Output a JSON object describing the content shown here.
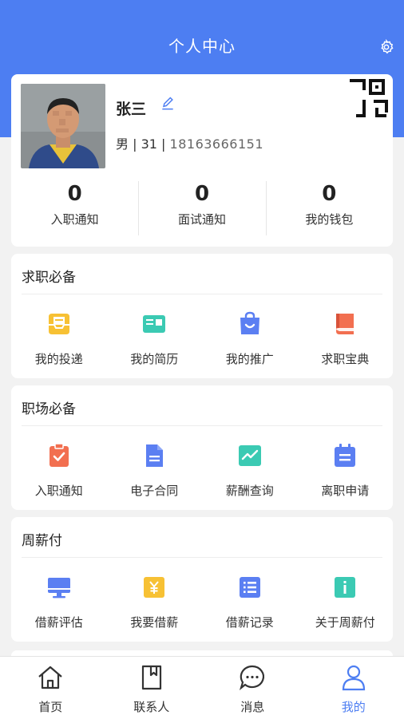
{
  "header": {
    "title": "个人中心",
    "bg_color": "#4d7ef2"
  },
  "profile": {
    "name": "张三",
    "gender": "男",
    "age": "31",
    "phone": "18163666151"
  },
  "stats": [
    {
      "value": "0",
      "label": "入职通知"
    },
    {
      "value": "0",
      "label": "面试通知"
    },
    {
      "value": "0",
      "label": "我的钱包"
    }
  ],
  "sections": [
    {
      "title": "求职必备",
      "items": [
        {
          "label": "我的投递",
          "icon": "inbox-icon",
          "color": "#f7c134"
        },
        {
          "label": "我的简历",
          "icon": "resume-card-icon",
          "color": "#3bcab3"
        },
        {
          "label": "我的推广",
          "icon": "shopping-bag-icon",
          "color": "#5b7ff2"
        },
        {
          "label": "求职宝典",
          "icon": "book-icon",
          "color": "#f26f50"
        }
      ]
    },
    {
      "title": "职场必备",
      "items": [
        {
          "label": "入职通知",
          "icon": "clipboard-check-icon",
          "color": "#f26f50"
        },
        {
          "label": "电子合同",
          "icon": "document-icon",
          "color": "#5b7ff2"
        },
        {
          "label": "薪酬查询",
          "icon": "chart-icon",
          "color": "#3bcab3"
        },
        {
          "label": "离职申请",
          "icon": "calendar-icon",
          "color": "#5b7ff2"
        }
      ]
    },
    {
      "title": "周薪付",
      "items": [
        {
          "label": "借薪评估",
          "icon": "monitor-icon",
          "color": "#5b7ff2"
        },
        {
          "label": "我要借薪",
          "icon": "yen-icon",
          "color": "#f7c134"
        },
        {
          "label": "借薪记录",
          "icon": "list-icon",
          "color": "#5b7ff2"
        },
        {
          "label": "关于周薪付",
          "icon": "info-icon",
          "color": "#3bcab3"
        }
      ]
    }
  ],
  "tabbar": [
    {
      "label": "首页",
      "icon": "home-icon",
      "active": false
    },
    {
      "label": "联系人",
      "icon": "bookmark-icon",
      "active": false
    },
    {
      "label": "消息",
      "icon": "chat-icon",
      "active": false
    },
    {
      "label": "我的",
      "icon": "user-icon",
      "active": true
    }
  ],
  "accent_color": "#4d7ef2"
}
